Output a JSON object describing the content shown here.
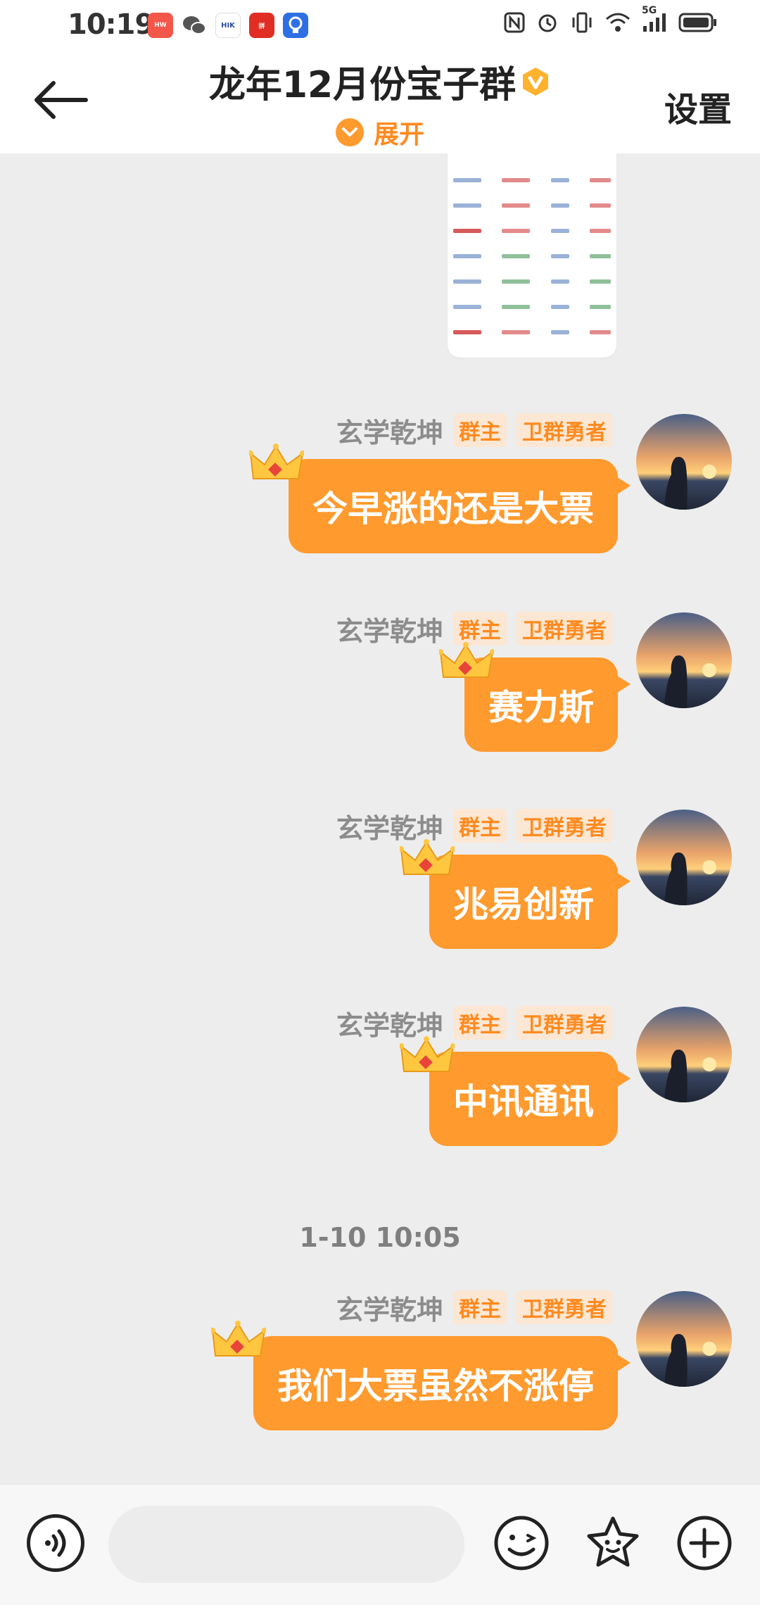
{
  "status_bar": {
    "time": "10:19",
    "apps": [
      {
        "name": "HUAWEI",
        "color": "#f2574a"
      },
      {
        "name": "WeChat",
        "color": "#555555"
      },
      {
        "name": "HIKIOT",
        "color": "#2b4fa8"
      },
      {
        "name": "pdd",
        "color": "#e02e24"
      },
      {
        "name": "bulb",
        "color": "#2f6fe4"
      }
    ],
    "network": "5G"
  },
  "header": {
    "title": "龙年12月份宝子群",
    "expand_label": "展开",
    "settings_label": "设置",
    "accent_color": "#ff8a1f"
  },
  "messages": [
    {
      "sender": "玄学乾坤",
      "tags": [
        "群主",
        "卫群勇者"
      ],
      "text": "今早涨的还是大票"
    },
    {
      "sender": "玄学乾坤",
      "tags": [
        "群主",
        "卫群勇者"
      ],
      "text": "赛力斯"
    },
    {
      "sender": "玄学乾坤",
      "tags": [
        "群主",
        "卫群勇者"
      ],
      "text": "兆易创新"
    },
    {
      "sender": "玄学乾坤",
      "tags": [
        "群主",
        "卫群勇者"
      ],
      "text": "中讯通讯"
    },
    {
      "sender": "玄学乾坤",
      "tags": [
        "群主",
        "卫群勇者"
      ],
      "text": "我们大票虽然不涨停"
    }
  ],
  "timestamp": "1-10 10:05",
  "input_bar": {
    "placeholder": "",
    "icons": [
      "voice-icon",
      "emoji-icon",
      "sticker-icon",
      "plus-icon"
    ]
  }
}
